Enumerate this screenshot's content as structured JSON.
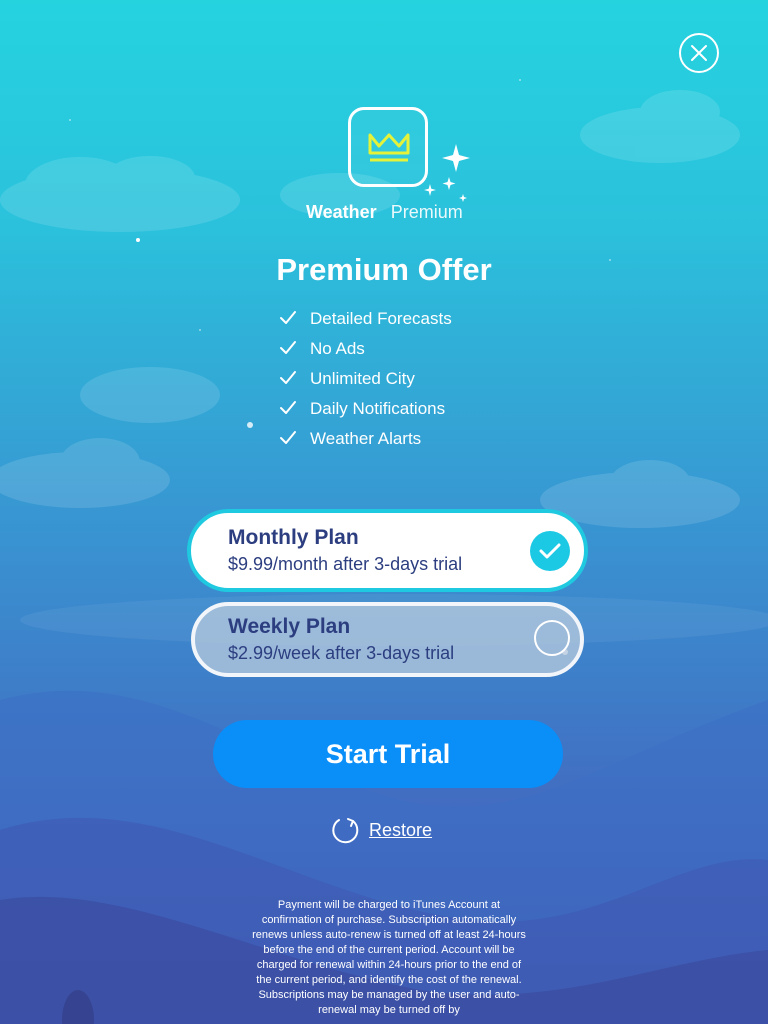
{
  "brand": {
    "name_bold": "Weather",
    "name_light": "Premium"
  },
  "offer": {
    "title": "Premium Offer",
    "features": [
      "Detailed Forecasts",
      "No Ads",
      "Unlimited City",
      "Daily Notifications",
      "Weather Alarts"
    ]
  },
  "plans": [
    {
      "name": "Monthly Plan",
      "price": "$9.99/month after 3-days trial",
      "selected": true
    },
    {
      "name": "Weekly Plan",
      "price": "$2.99/week after 3-days trial",
      "selected": false
    }
  ],
  "actions": {
    "start_trial": "Start Trial",
    "restore": "Restore"
  },
  "legal": "Payment will be charged to iTunes Account at confirmation of purchase. Subscription automatically renews unless auto-renew is turned off at least 24-hours before the end of the current period. Account will be charged for renewal within 24-hours prior to the end of the current period, and identify the cost of the renewal. Subscriptions may be managed by the user and auto-renewal may be turned off by",
  "icons": {
    "close": "close-icon",
    "crown": "crown-icon",
    "sparkle": "sparkle-icon",
    "check": "check-icon",
    "restore": "refresh-icon"
  },
  "colors": {
    "accent": "#0a8ef8",
    "selected_check": "#1cc9e4",
    "crown": "#e4f23a",
    "plan_text": "#2c3e80"
  }
}
